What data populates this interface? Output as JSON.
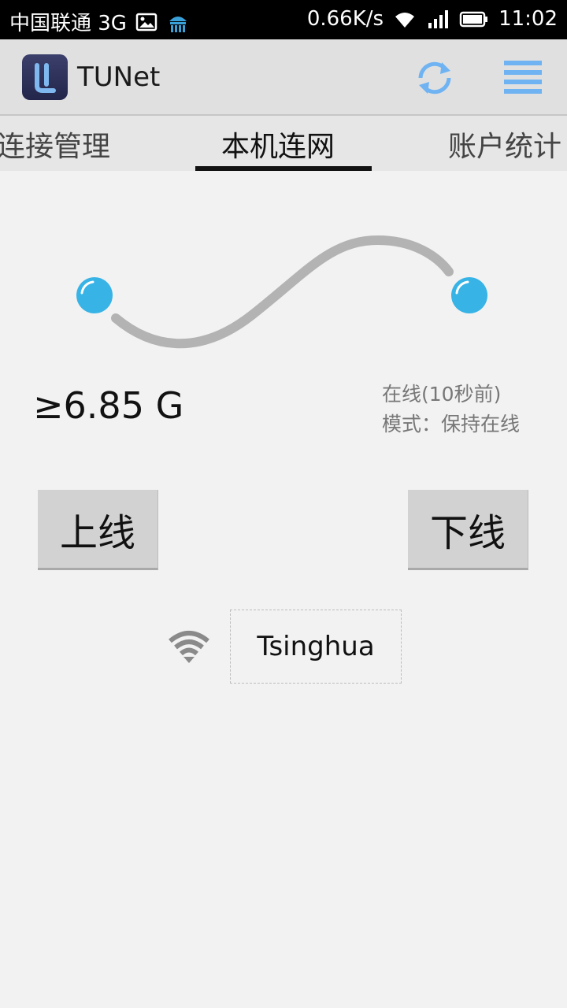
{
  "status_bar": {
    "carrier": "中国联通 3G",
    "speed": "0.66K/s",
    "time": "11:02",
    "icons": [
      "gallery-icon",
      "app-notification-icon",
      "wifi-icon",
      "signal-icon",
      "battery-icon"
    ]
  },
  "app": {
    "title": "TUNet",
    "accent": "#6fb3f2"
  },
  "tabs": [
    {
      "label": "连接管理"
    },
    {
      "label": "本机连网",
      "active": true
    },
    {
      "label": "账户统计"
    }
  ],
  "connection": {
    "usage": "≥6.85 G",
    "status_line": "在线(10秒前)",
    "mode_line": "模式：保持在线",
    "node_color": "#37b3e6"
  },
  "buttons": {
    "online": "上线",
    "offline": "下线"
  },
  "network": {
    "ssid": "Tsinghua"
  }
}
